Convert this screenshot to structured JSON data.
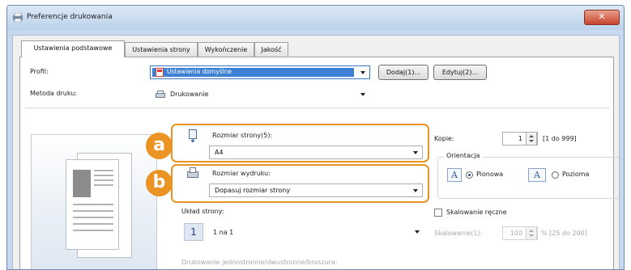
{
  "window": {
    "title": "Preferencje drukowania",
    "close_glyph": "✕"
  },
  "tabs": [
    {
      "label": "Ustawienia podstawowe"
    },
    {
      "label": "Ustawienia strony"
    },
    {
      "label": "Wykończenie"
    },
    {
      "label": "Jakość"
    }
  ],
  "profile": {
    "label": "Profil:",
    "value": "Ustawienia domyślne",
    "add_button": "Dodaj(1)...",
    "edit_button": "Edytuj(2)..."
  },
  "print_method": {
    "label": "Metoda druku:",
    "value": "Drukowanie"
  },
  "page_size": {
    "label": "Rozmiar strony(5):",
    "value": "A4"
  },
  "output_size": {
    "label": "Rozmiar wydruku:",
    "value": "Dopasuj rozmiar strony"
  },
  "copies": {
    "label": "Kopie:",
    "value": "1",
    "range": "[1 do 999]"
  },
  "orientation": {
    "label": "Orientacja",
    "portrait": "Pionowa",
    "landscape": "Pozioma",
    "icon_letter": "A",
    "selected": "portrait"
  },
  "layout": {
    "label": "Układ strony:",
    "value": "1 na 1",
    "icon_number": "1"
  },
  "manual_scaling": {
    "label": "Skalowanie ręczne",
    "checked": false
  },
  "scaling": {
    "label": "Skalowanie(1):",
    "value": "100",
    "unit_range": "% [25 do 200]"
  },
  "duplex_label": "Drukowanie jednostronne/dwustronne/broszura:",
  "callouts": {
    "a": "a",
    "b": "b"
  },
  "colors": {
    "callout": "#ec9423",
    "titlebar": "#c7d9ee",
    "selected_icon": "#d93838"
  }
}
